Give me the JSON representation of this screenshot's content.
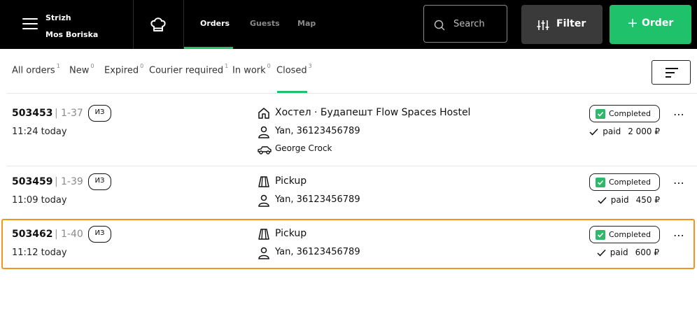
{
  "header": {
    "venue_line1": "Strizh",
    "venue_line2": "Mos Boriska",
    "nav_tabs": [
      {
        "label": "Orders",
        "active": true
      },
      {
        "label": "Guests",
        "active": false
      },
      {
        "label": "Map",
        "active": false
      }
    ],
    "search_placeholder": "Search",
    "filter_label": "Filter",
    "order_label": "Order",
    "order_plus": "+"
  },
  "status_tabs": [
    {
      "label": "All orders",
      "count": "1"
    },
    {
      "label": "New",
      "count": "0"
    },
    {
      "label": "Expired",
      "count": "0"
    },
    {
      "label": "Courier required",
      "count": "1"
    },
    {
      "label": "In work",
      "count": "0"
    },
    {
      "label": "Closed",
      "count": "3",
      "active": true
    }
  ],
  "orders": [
    {
      "id": "503453",
      "separator": "|",
      "slot": "1-37",
      "type_badge": "ИЗ",
      "time": "11:24 today",
      "address_icon": "house-icon",
      "address": "Хостел · Будапешт Flow Spaces Hostel",
      "client": "Yan, 36123456789",
      "courier": "George Crock",
      "status": "Completed",
      "paid_label": "paid",
      "amount": "2 000 ₽"
    },
    {
      "id": "503459",
      "separator": "|",
      "slot": "1-39",
      "type_badge": "ИЗ",
      "time": "11:09 today",
      "address_icon": "pickup-icon",
      "address": "Pickup",
      "client": "Yan, 36123456789",
      "status": "Completed",
      "paid_label": "paid",
      "amount": "450 ₽"
    },
    {
      "id": "503462",
      "separator": "|",
      "slot": "1-40",
      "type_badge": "ИЗ",
      "time": "11:12 today",
      "address_icon": "pickup-icon",
      "address": "Pickup",
      "client": "Yan, 36123456789",
      "status": "Completed",
      "paid_label": "paid",
      "amount": "600 ₽",
      "highlighted": true
    }
  ],
  "more_label": "⋯",
  "colors": {
    "accent": "#1fc26b",
    "highlight": "#f39420",
    "topbar": "#000000"
  }
}
